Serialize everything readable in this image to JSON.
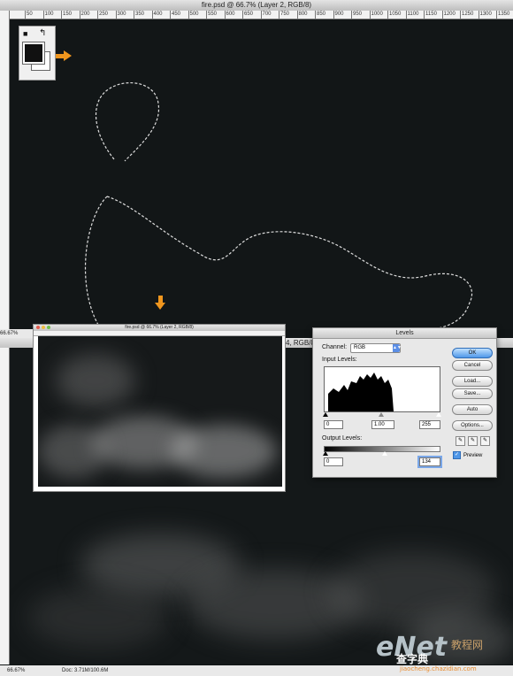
{
  "top_window": {
    "title": "fire.psd @ 66.7% (Layer 2, RGB/8)",
    "ruler_ticks": [
      "50",
      "100",
      "150",
      "200",
      "250",
      "300",
      "350",
      "400",
      "450",
      "500",
      "550",
      "600",
      "650",
      "700",
      "750",
      "800",
      "850",
      "900",
      "950",
      "1000",
      "1050",
      "1100",
      "1150",
      "1200",
      "1250",
      "1300",
      "1350",
      "1400"
    ],
    "zoom": "66.67%",
    "partial_title": "4, RGB/8)"
  },
  "inset_window": {
    "title": "fire.psd @ 66.7% (Layer 2, RGB/8)"
  },
  "levels_dialog": {
    "title": "Levels",
    "channel_label": "Channel:",
    "channel_value": "RGB",
    "input_levels_label": "Input Levels:",
    "input_black": "0",
    "input_gamma": "1.00",
    "input_white": "255",
    "output_levels_label": "Output Levels:",
    "output_black": "0",
    "output_white": "134",
    "buttons": {
      "ok": "OK",
      "cancel": "Cancel",
      "load": "Load...",
      "save": "Save...",
      "auto": "Auto",
      "options": "Options..."
    },
    "preview_label": "Preview",
    "preview_checked": true
  },
  "bottom_window": {
    "zoom": "66.67%",
    "doc_size": "Doc: 3.71M/100.6M"
  },
  "watermark": {
    "logo": "eNet",
    "site_cn": "教程网",
    "site_cn2": "查字典",
    "url": "jiaocheng.chazidian.com"
  },
  "colors": {
    "accent_arrow": "#f0961e",
    "canvas_bg": "#121617",
    "ok_button": "#4f97e8"
  },
  "icons": [
    "arrow-right-icon",
    "arrow-down-icon",
    "eyedropper-black-icon",
    "eyedropper-gray-icon",
    "eyedropper-white-icon",
    "swap-colors-icon",
    "default-colors-icon"
  ]
}
